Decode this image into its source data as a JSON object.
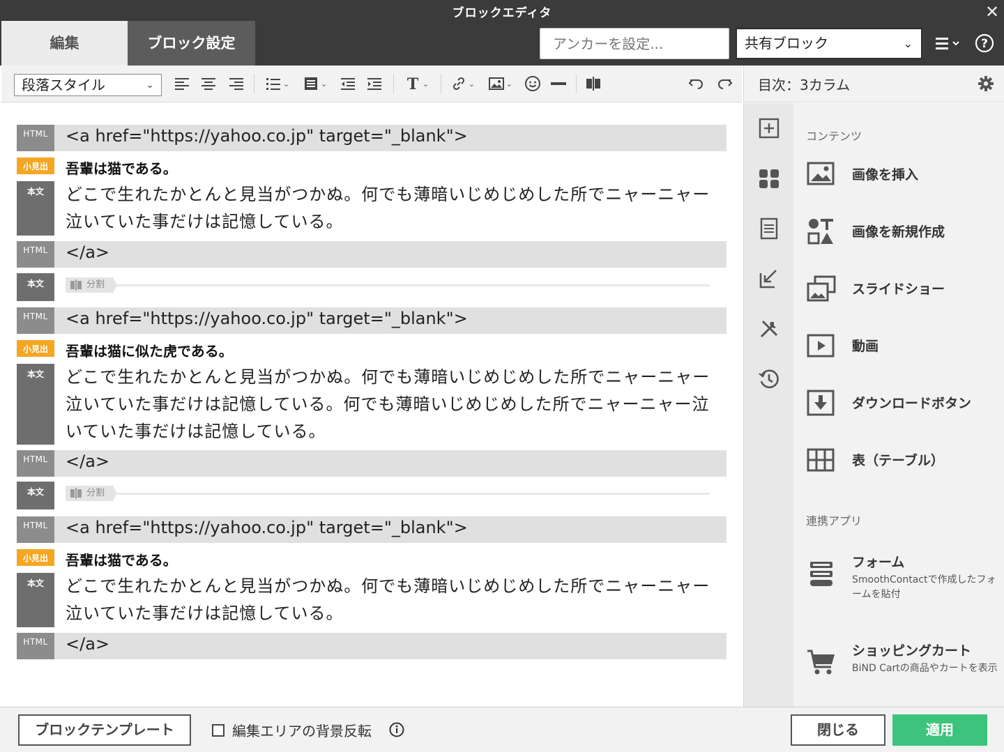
{
  "window": {
    "title": "ブロックエディタ"
  },
  "header": {
    "tabs": [
      {
        "label": "編集"
      },
      {
        "label": "ブロック設定"
      }
    ],
    "anchor_placeholder": "アンカーを設定...",
    "shared_block_value": "共有ブロック"
  },
  "toolbar": {
    "paragraph_style": "段落スタイル"
  },
  "sidebar": {
    "header": "目次：3カラム",
    "section_contents": "コンテンツ",
    "section_apps": "連携アプリ",
    "items": [
      {
        "label": "画像を挿入",
        "icon": "image-icon"
      },
      {
        "label": "画像を新規作成",
        "icon": "shapes-icon"
      },
      {
        "label": "スライドショー",
        "icon": "slideshow-icon"
      },
      {
        "label": "動画",
        "icon": "video-icon"
      },
      {
        "label": "ダウンロードボタン",
        "icon": "download-icon"
      },
      {
        "label": "表（テーブル）",
        "icon": "table-icon"
      }
    ],
    "apps": [
      {
        "label": "フォーム",
        "desc": "SmoothContactで作成したフォームを貼付",
        "icon": "form-icon"
      },
      {
        "label": "ショッピングカート",
        "desc": "BiND Cartの商品やカートを表示",
        "icon": "cart-icon"
      }
    ]
  },
  "tags": {
    "html": "HTML",
    "heading": "小見出",
    "body": "本文"
  },
  "editor": {
    "split_label": "分割",
    "block1": {
      "open": "<a href=\"https://yahoo.co.jp\" target=\"_blank\">",
      "heading": "吾輩は猫である。",
      "body": "どこで生れたかとんと見当がつかぬ。何でも薄暗いじめじめした所でニャーニャー泣いていた事だけは記憶している。",
      "close": "</a>"
    },
    "block2": {
      "open": "<a href=\"https://yahoo.co.jp\" target=\"_blank\">",
      "heading": "吾輩は猫に似た虎である。",
      "body": "どこで生れたかとんと見当がつかぬ。何でも薄暗いじめじめした所でニャーニャー泣いていた事だけは記憶している。何でも薄暗いじめじめした所でニャーニャー泣いていた事だけは記憶している。",
      "close": "</a>"
    },
    "block3": {
      "open": "<a href=\"https://yahoo.co.jp\" target=\"_blank\">",
      "heading": "吾輩は猫である。",
      "body": "どこで生れたかとんと見当がつかぬ。何でも薄暗いじめじめした所でニャーニャー泣いていた事だけは記憶している。",
      "close": "</a>"
    }
  },
  "footer": {
    "template_button": "ブロックテンプレート",
    "invert_label": "編集エリアの背景反転",
    "close_button": "閉じる",
    "apply_button": "適用"
  },
  "colors": {
    "apply": "#3cc47c",
    "heading_tag": "#f5a623",
    "titlebar": "#3b3b3b"
  }
}
